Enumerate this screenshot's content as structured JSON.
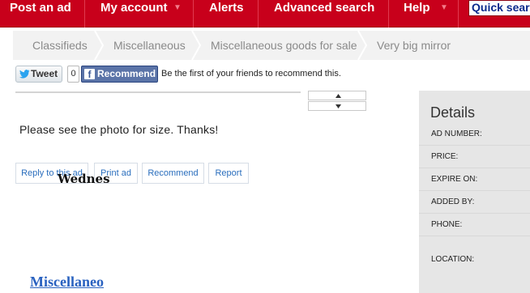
{
  "nav": {
    "post_ad": "Post an ad",
    "my_account": "My account",
    "alerts": "Alerts",
    "advanced_search": "Advanced search",
    "help": "Help",
    "quick_search": "Quick search",
    "dropdown_caret": "▼",
    "bg_color": "#c8001b"
  },
  "breadcrumb": [
    "Classifieds",
    "Miscellaneous",
    "Miscellaneous goods for sale",
    "Very big mirror"
  ],
  "social": {
    "tweet_label": "Tweet",
    "count": "0",
    "recommend_label": "Recommend",
    "recommend_text": "Be the first of your friends to recommend this."
  },
  "ad": {
    "description": "Please see the photo for size. Thanks!"
  },
  "actions": {
    "reply": "Reply to this ad",
    "print": "Print ad",
    "recommend": "Recommend",
    "report": "Report"
  },
  "details": {
    "title": "Details",
    "ad_number_label": "AD NUMBER:",
    "price_label": "PRICE:",
    "expire_label": "EXPIRE ON:",
    "expire_value": "Wednes",
    "added_by_label": "ADDED BY:",
    "phone_label": "PHONE:",
    "location_label": "LOCATION:",
    "location_link": "Miscellaneo"
  }
}
